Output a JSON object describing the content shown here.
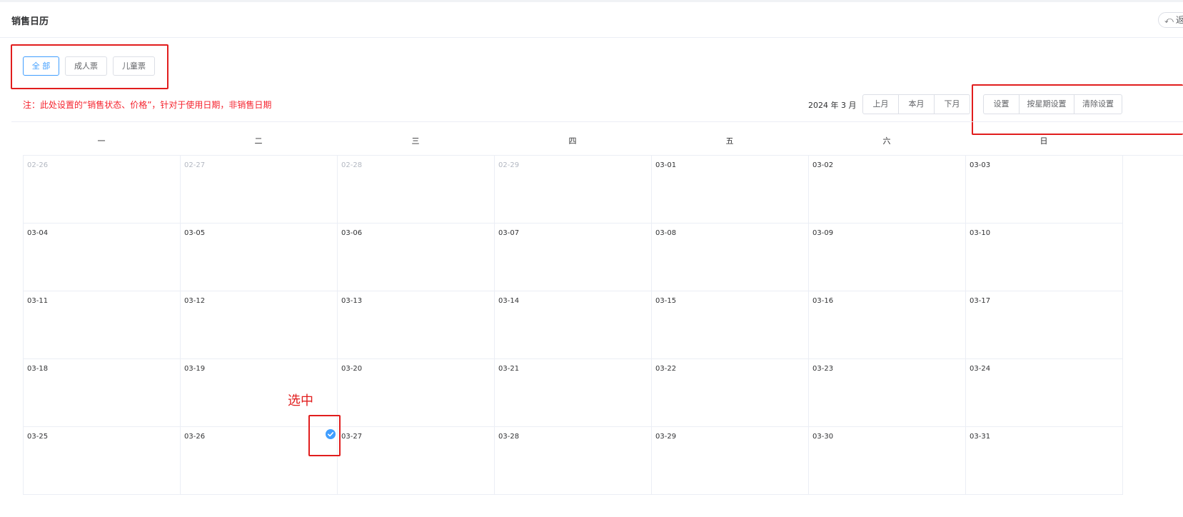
{
  "header": {
    "title": "销售日历",
    "back_icon": "undo-arrow-icon",
    "back_label": "返回"
  },
  "tabs": [
    {
      "label": "全 部",
      "active": true
    },
    {
      "label": "成人票",
      "active": false
    },
    {
      "label": "儿童票",
      "active": false
    }
  ],
  "note": "注：此处设置的“销售状态、价格”，针对于使用日期，非销售日期",
  "toolbar": {
    "month_label": "2024 年 3 月",
    "prev_month": "上月",
    "this_month": "本月",
    "next_month": "下月",
    "set": "设置",
    "set_by_week": "按星期设置",
    "clear_set": "清除设置"
  },
  "weekdays": [
    "一",
    "二",
    "三",
    "四",
    "五",
    "六",
    "日"
  ],
  "calendar": {
    "weeks": [
      [
        {
          "d": "02-26",
          "other": true
        },
        {
          "d": "02-27",
          "other": true
        },
        {
          "d": "02-28",
          "other": true
        },
        {
          "d": "02-29",
          "other": true
        },
        {
          "d": "03-01"
        },
        {
          "d": "03-02"
        },
        {
          "d": "03-03"
        }
      ],
      [
        {
          "d": "03-04"
        },
        {
          "d": "03-05"
        },
        {
          "d": "03-06"
        },
        {
          "d": "03-07"
        },
        {
          "d": "03-08"
        },
        {
          "d": "03-09"
        },
        {
          "d": "03-10"
        }
      ],
      [
        {
          "d": "03-11"
        },
        {
          "d": "03-12"
        },
        {
          "d": "03-13"
        },
        {
          "d": "03-14"
        },
        {
          "d": "03-15"
        },
        {
          "d": "03-16"
        },
        {
          "d": "03-17"
        }
      ],
      [
        {
          "d": "03-18"
        },
        {
          "d": "03-19"
        },
        {
          "d": "03-20"
        },
        {
          "d": "03-21"
        },
        {
          "d": "03-22"
        },
        {
          "d": "03-23"
        },
        {
          "d": "03-24"
        }
      ],
      [
        {
          "d": "03-25"
        },
        {
          "d": "03-26",
          "selected": true
        },
        {
          "d": "03-27"
        },
        {
          "d": "03-28"
        },
        {
          "d": "03-29"
        },
        {
          "d": "03-30"
        },
        {
          "d": "03-31"
        }
      ]
    ]
  },
  "annotation": "选中",
  "colors": {
    "accent": "#409eff",
    "annotation_red": "#e11d1d",
    "note_red": "#f5222d"
  }
}
